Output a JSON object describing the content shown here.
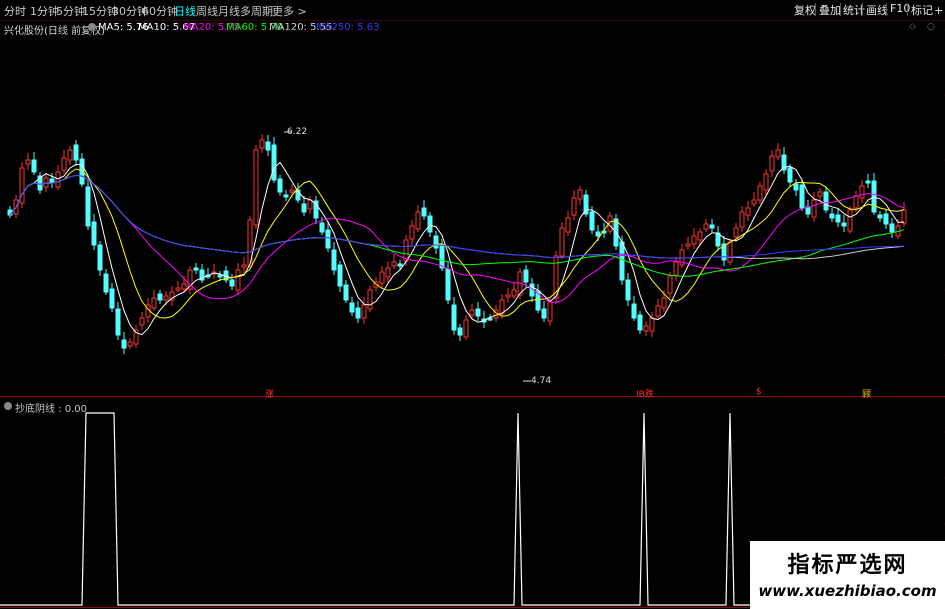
{
  "toolbar": {
    "periods": [
      "分时",
      "1分钟",
      "5分钟",
      "15分钟",
      "30分钟",
      "60分钟",
      "日线",
      "周线",
      "月线",
      "多周期",
      "更多 >"
    ],
    "active_period": "日线",
    "right_buttons": [
      "复权",
      "叠加",
      "统计",
      "画线",
      "F10",
      "标记",
      "+自"
    ]
  },
  "chart_header": {
    "stock_title": "兴化股份(日线 前复权)",
    "ma_labels": [
      {
        "text": "MA5: 5.76",
        "color": "#ffffff"
      },
      {
        "text": "MA10: 5.67",
        "color": "#ffffff"
      },
      {
        "text": "MA20: 5.75",
        "color": "#ff00ff"
      },
      {
        "text": "MA60: 5.70",
        "color": "#00ff00"
      },
      {
        "text": "MA120: 5.55",
        "color": "#d0d0d0"
      },
      {
        "text": "MA250: 5.63",
        "color": "#3a3aff"
      }
    ]
  },
  "price_labels": {
    "high": "6.22",
    "low": "4.74"
  },
  "signals": [
    {
      "text": "涨",
      "color": "#ff3030"
    },
    {
      "text": "IB跌",
      "color": "#ff3030"
    },
    {
      "text": "$",
      "color": "#ff3030"
    },
    {
      "text": "顾",
      "color": "#ffcc00"
    }
  ],
  "indicator": {
    "title": "抄底阴线 : 0.00"
  },
  "watermark": {
    "title": "指标严选网",
    "url": "www.xuezhibiao.com"
  },
  "colors": {
    "up": "#ff3232",
    "down": "#54ffff",
    "ma5": "#ffffff",
    "ma10": "#ffff00",
    "ma20": "#ff00ff",
    "ma60": "#00ff00",
    "ma120": "#cccccc",
    "ma250": "#3a3aff"
  }
}
